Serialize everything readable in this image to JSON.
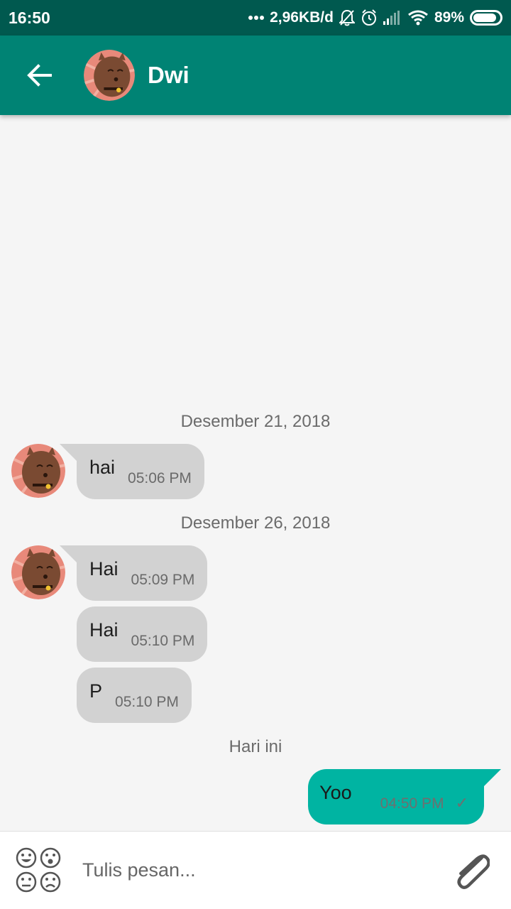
{
  "status_bar": {
    "time": "16:50",
    "network_speed": "2,96KB/d",
    "battery": "89%",
    "battery_level": 0.89
  },
  "header": {
    "contact_name": "Dwi"
  },
  "conversation": {
    "sections": [
      {
        "date": "Desember 21, 2018",
        "messages": [
          {
            "text": "hai",
            "time": "05:06 PM"
          }
        ]
      },
      {
        "date": "Desember 26, 2018",
        "messages": [
          {
            "text": "Hai",
            "time": "05:09 PM"
          },
          {
            "text": "Hai",
            "time": "05:10 PM"
          },
          {
            "text": "P",
            "time": "05:10 PM"
          }
        ]
      },
      {
        "date": "Hari ini",
        "messages": [
          {
            "text": "Yoo",
            "time": "04:50 PM",
            "outgoing": true,
            "status": "sent"
          }
        ]
      }
    ]
  },
  "composer": {
    "placeholder": "Tulis pesan..."
  },
  "colors": {
    "status_bar": "#00594f",
    "app_bar": "#008374",
    "incoming_bubble": "#d2d2d2",
    "outgoing_bubble": "#00b4a2"
  }
}
